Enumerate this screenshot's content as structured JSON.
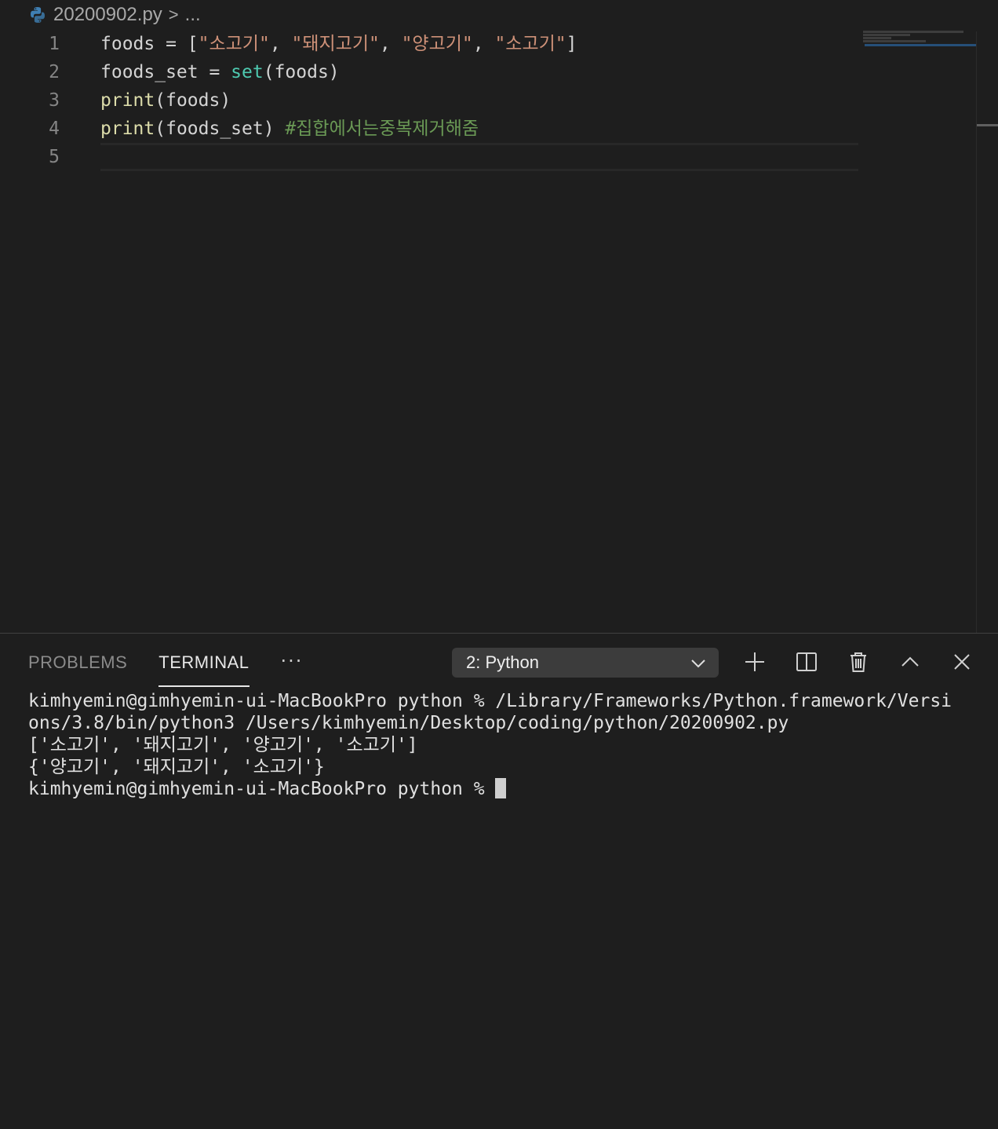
{
  "breadcrumb": {
    "file": "20200902.py",
    "separator": ">",
    "more": "..."
  },
  "editor": {
    "line_numbers": [
      "1",
      "2",
      "3",
      "4",
      "5"
    ],
    "lines": [
      [
        {
          "t": "foods = [",
          "c": ""
        },
        {
          "t": "\"소고기\"",
          "c": "str"
        },
        {
          "t": ", ",
          "c": ""
        },
        {
          "t": "\"돼지고기\"",
          "c": "str"
        },
        {
          "t": ", ",
          "c": ""
        },
        {
          "t": "\"양고기\"",
          "c": "str"
        },
        {
          "t": ", ",
          "c": ""
        },
        {
          "t": "\"소고기\"",
          "c": "str"
        },
        {
          "t": "]",
          "c": ""
        }
      ],
      [
        {
          "t": "foods_set = ",
          "c": ""
        },
        {
          "t": "set",
          "c": "builtin"
        },
        {
          "t": "(foods)",
          "c": ""
        }
      ],
      [
        {
          "t": "print",
          "c": "fn"
        },
        {
          "t": "(foods)",
          "c": ""
        }
      ],
      [
        {
          "t": "print",
          "c": "fn"
        },
        {
          "t": "(foods_set) ",
          "c": ""
        },
        {
          "t": "#집합에서는중복제거해줌",
          "c": "comment"
        }
      ],
      []
    ]
  },
  "panel": {
    "tabs": [
      "PROBLEMS",
      "TERMINAL"
    ],
    "active_tab": "TERMINAL",
    "more": "···",
    "terminal_select": "2: Python"
  },
  "terminal": {
    "lines": [
      "kimhyemin@gimhyemin-ui-MacBookPro python % /Library/Frameworks/Python.framework/Versi",
      "ons/3.8/bin/python3 /Users/kimhyemin/Desktop/coding/python/20200902.py",
      "['소고기', '돼지고기', '양고기', '소고기']",
      "{'양고기', '돼지고기', '소고기'}"
    ],
    "prompt": "kimhyemin@gimhyemin-ui-MacBookPro python % "
  },
  "colors": {
    "background": "#1e1e1e",
    "string": "#ce9178",
    "builtin": "#4ec9b0",
    "function": "#dcdcaa",
    "comment": "#6a9955"
  }
}
